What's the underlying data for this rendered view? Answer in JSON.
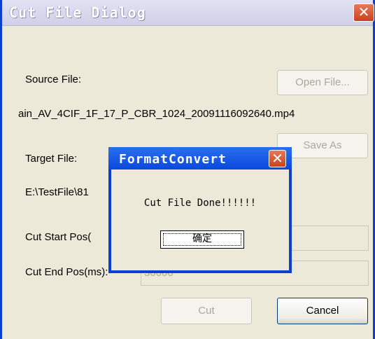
{
  "dialog": {
    "title": "Cut File Dialog",
    "close_glyph": "✕",
    "source_label": "Source File:",
    "open_file_label": "Open File...",
    "source_path": "ain_AV_4CIF_1F_17_P_CBR_1024_20091116092640.mp4",
    "target_label": "Target File:",
    "save_as_label": "Save As",
    "target_path": "E:\\TestFile\\81",
    "cut_start_label": "Cut Start Pos(",
    "cut_end_label": "Cut End Pos(ms):",
    "cut_end_value": "30000",
    "cut_label": "Cut",
    "cancel_label": "Cancel"
  },
  "message_box": {
    "title": "FormatConvert",
    "close_glyph": "✕",
    "message": "Cut File Done!!!!!!",
    "ok_label": "确定"
  },
  "colors": {
    "window_bg": "#ece9d8",
    "title_active": "#0a48dc",
    "close_red": "#d8522e"
  }
}
